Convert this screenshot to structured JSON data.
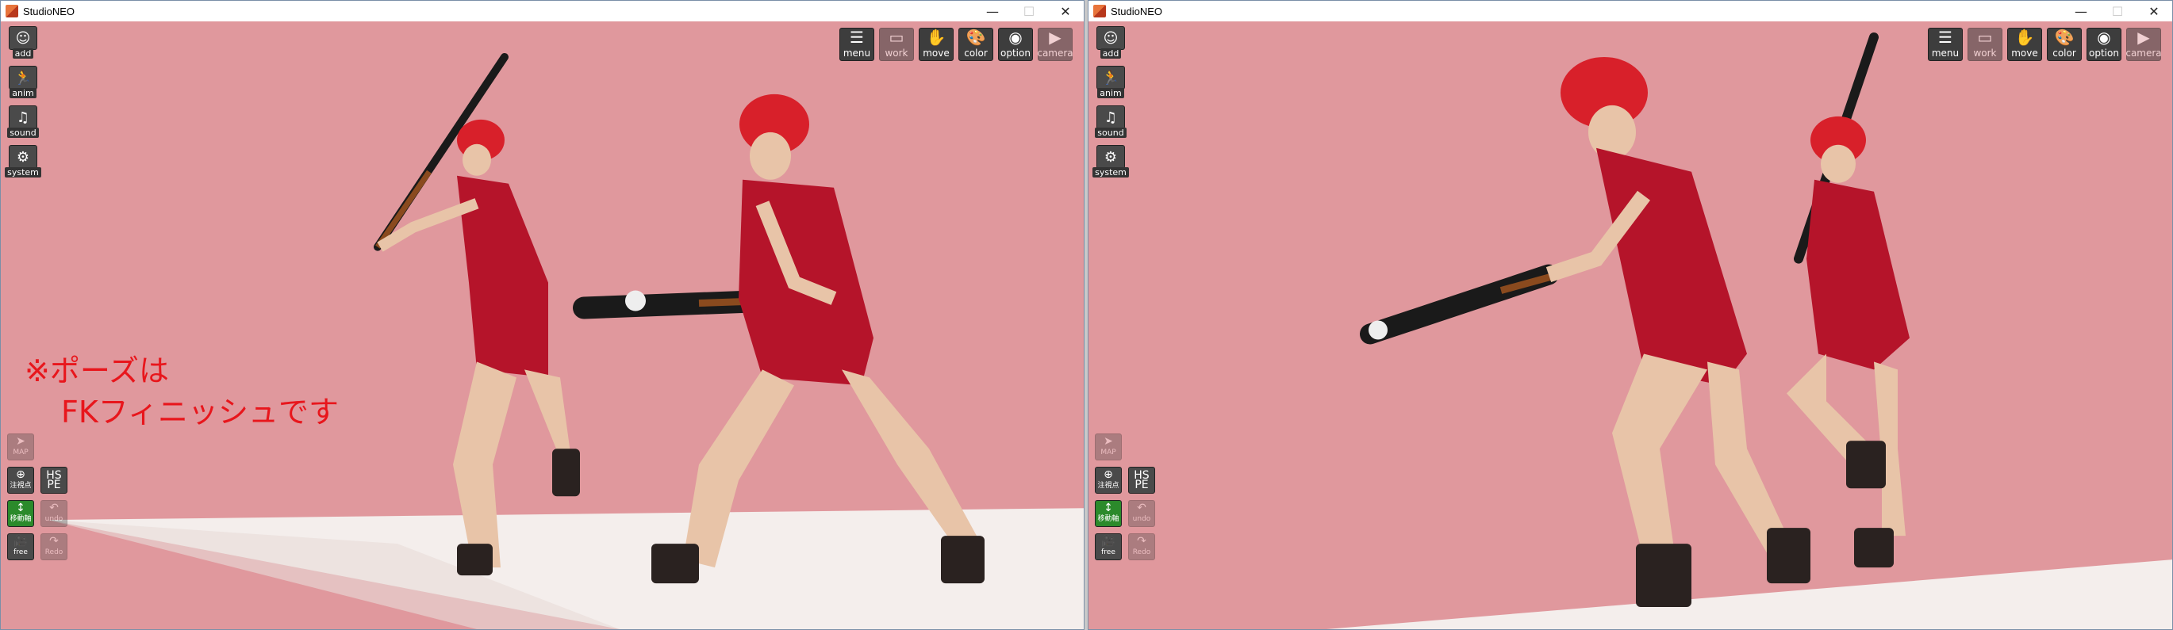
{
  "windows": [
    {
      "title": "StudioNEO",
      "controls": {
        "minimize": "—",
        "maximize": "☐",
        "close": "✕"
      },
      "side_buttons": [
        {
          "label": "add",
          "icon": "person-icon"
        },
        {
          "label": "anim",
          "icon": "running-person-icon"
        },
        {
          "label": "sound",
          "icon": "music-note-icon"
        },
        {
          "label": "system",
          "icon": "gears-icon"
        }
      ],
      "bottom_buttons": {
        "map": "MAP",
        "center": "注視点",
        "hspe_top": "HS",
        "hspe_bottom": "PE",
        "move_axis": "移動軸",
        "undo": "undo",
        "camera_mode": "free",
        "redo": "Redo"
      },
      "top_buttons": [
        {
          "label": "menu",
          "icon": "menu-list-icon"
        },
        {
          "label": "work",
          "icon": "work-panel-icon"
        },
        {
          "label": "move",
          "icon": "hand-icon"
        },
        {
          "label": "color",
          "icon": "palette-icon"
        },
        {
          "label": "option",
          "icon": "eye-icon"
        },
        {
          "label": "camera",
          "icon": "camera-icon"
        }
      ],
      "note_line1": "※ポーズは",
      "note_line2": "FKフィニッシュです"
    },
    {
      "title": "StudioNEO",
      "controls": {
        "minimize": "—",
        "maximize": "☐",
        "close": "✕"
      },
      "side_buttons": [
        {
          "label": "add",
          "icon": "person-icon"
        },
        {
          "label": "anim",
          "icon": "running-person-icon"
        },
        {
          "label": "sound",
          "icon": "music-note-icon"
        },
        {
          "label": "system",
          "icon": "gears-icon"
        }
      ],
      "bottom_buttons": {
        "map": "MAP",
        "center": "注視点",
        "hspe_top": "HS",
        "hspe_bottom": "PE",
        "move_axis": "移動軸",
        "undo": "undo",
        "camera_mode": "free",
        "redo": "Redo"
      },
      "top_buttons": [
        {
          "label": "menu",
          "icon": "menu-list-icon"
        },
        {
          "label": "work",
          "icon": "work-panel-icon"
        },
        {
          "label": "move",
          "icon": "hand-icon"
        },
        {
          "label": "color",
          "icon": "palette-icon"
        },
        {
          "label": "option",
          "icon": "eye-icon"
        },
        {
          "label": "camera",
          "icon": "camera-icon"
        }
      ]
    }
  ],
  "colors": {
    "background": "#e0989d",
    "floor": "#f3ecea",
    "note": "#e8161c",
    "shirt": "#b5142a",
    "helmet": "#d8202a",
    "bat": "#1a1a1a"
  }
}
